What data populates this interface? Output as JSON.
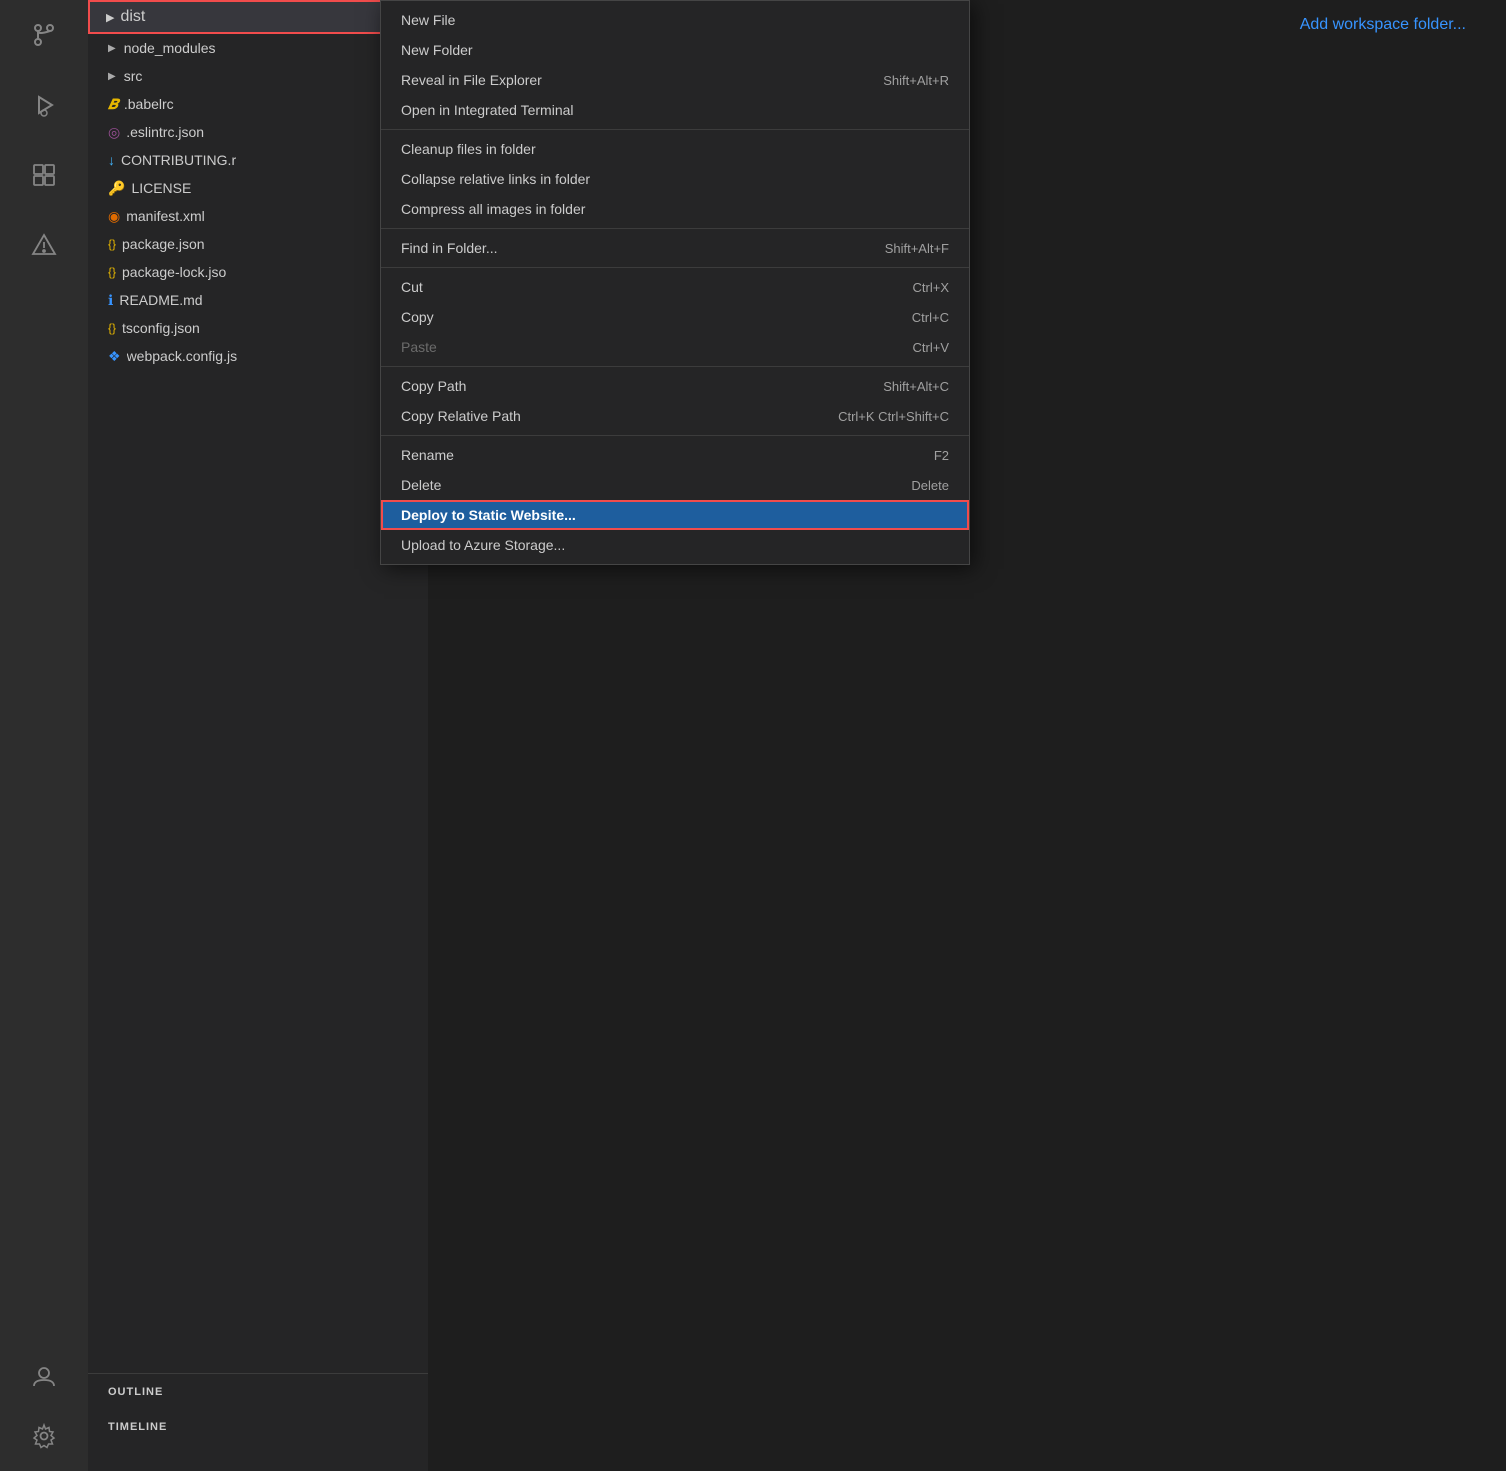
{
  "activity_bar": {
    "icons": [
      {
        "name": "source-control-icon",
        "symbol": "⑂",
        "active": false
      },
      {
        "name": "run-debug-icon",
        "symbol": "▷",
        "active": false
      },
      {
        "name": "extensions-icon",
        "symbol": "⊞",
        "active": false
      },
      {
        "name": "warning-icon",
        "symbol": "△",
        "active": false
      }
    ],
    "bottom_icons": [
      {
        "name": "account-icon",
        "symbol": "⊙"
      },
      {
        "name": "settings-icon",
        "symbol": "⚙"
      }
    ]
  },
  "sidebar": {
    "files": [
      {
        "id": "dist",
        "label": "dist",
        "icon": "▶",
        "type": "folder",
        "highlighted": true
      },
      {
        "id": "node_modules",
        "label": "node_modules",
        "icon": "▶",
        "type": "folder",
        "color": "#cccccc"
      },
      {
        "id": "src",
        "label": "src",
        "icon": "▶",
        "type": "folder",
        "color": "#cccccc"
      },
      {
        "id": "babelrc",
        "label": ".babelrc",
        "icon": "𝑩",
        "type": "file",
        "color": "#e6b600"
      },
      {
        "id": "eslintrc",
        "label": ".eslintrc.json",
        "icon": "◎",
        "type": "file",
        "color": "#9b4f96"
      },
      {
        "id": "contributing",
        "label": "CONTRIBUTING.r",
        "icon": "↓",
        "type": "file",
        "color": "#41b3f9"
      },
      {
        "id": "license",
        "label": "LICENSE",
        "icon": "🔑",
        "type": "file",
        "color": "#e6b600"
      },
      {
        "id": "manifest",
        "label": "manifest.xml",
        "icon": "◉",
        "type": "file",
        "color": "#e06b00"
      },
      {
        "id": "package",
        "label": "package.json",
        "icon": "{}",
        "type": "file",
        "color": "#e6b600"
      },
      {
        "id": "package_lock",
        "label": "package-lock.jso",
        "icon": "{}",
        "type": "file",
        "color": "#e6b600"
      },
      {
        "id": "readme",
        "label": "README.md",
        "icon": "ℹ",
        "type": "file",
        "color": "#3794ff"
      },
      {
        "id": "tsconfig",
        "label": "tsconfig.json",
        "icon": "{}",
        "type": "file",
        "color": "#e6b600"
      },
      {
        "id": "webpack",
        "label": "webpack.config.js",
        "icon": "❖",
        "type": "file",
        "color": "#3794ff"
      }
    ],
    "outline_label": "OUTLINE",
    "timeline_label": "TIMELINE"
  },
  "top_bar": {
    "add_workspace_label": "Add workspace folder..."
  },
  "context_menu": {
    "items": [
      {
        "id": "new-file",
        "label": "New File",
        "shortcut": "",
        "disabled": false,
        "separator_after": false
      },
      {
        "id": "new-folder",
        "label": "New Folder",
        "shortcut": "",
        "disabled": false,
        "separator_after": false
      },
      {
        "id": "reveal-explorer",
        "label": "Reveal in File Explorer",
        "shortcut": "Shift+Alt+R",
        "disabled": false,
        "separator_after": false
      },
      {
        "id": "open-terminal",
        "label": "Open in Integrated Terminal",
        "shortcut": "",
        "disabled": false,
        "separator_after": true
      },
      {
        "id": "cleanup-files",
        "label": "Cleanup files in folder",
        "shortcut": "",
        "disabled": false,
        "separator_after": false
      },
      {
        "id": "collapse-links",
        "label": "Collapse relative links in folder",
        "shortcut": "",
        "disabled": false,
        "separator_after": false
      },
      {
        "id": "compress-images",
        "label": "Compress all images in folder",
        "shortcut": "",
        "disabled": false,
        "separator_after": true
      },
      {
        "id": "find-in-folder",
        "label": "Find in Folder...",
        "shortcut": "Shift+Alt+F",
        "disabled": false,
        "separator_after": true
      },
      {
        "id": "cut",
        "label": "Cut",
        "shortcut": "Ctrl+X",
        "disabled": false,
        "separator_after": false
      },
      {
        "id": "copy",
        "label": "Copy",
        "shortcut": "Ctrl+C",
        "disabled": false,
        "separator_after": false
      },
      {
        "id": "paste",
        "label": "Paste",
        "shortcut": "Ctrl+V",
        "disabled": true,
        "separator_after": true
      },
      {
        "id": "copy-path",
        "label": "Copy Path",
        "shortcut": "Shift+Alt+C",
        "disabled": false,
        "separator_after": false
      },
      {
        "id": "copy-relative-path",
        "label": "Copy Relative Path",
        "shortcut": "Ctrl+K Ctrl+Shift+C",
        "disabled": false,
        "separator_after": true
      },
      {
        "id": "rename",
        "label": "Rename",
        "shortcut": "F2",
        "disabled": false,
        "separator_after": false
      },
      {
        "id": "delete",
        "label": "Delete",
        "shortcut": "Delete",
        "disabled": false,
        "separator_after": false
      },
      {
        "id": "deploy-static",
        "label": "Deploy to Static Website...",
        "shortcut": "",
        "disabled": false,
        "highlighted": true,
        "separator_after": false
      },
      {
        "id": "upload-azure",
        "label": "Upload to Azure Storage...",
        "shortcut": "",
        "disabled": false,
        "separator_after": false
      }
    ]
  }
}
